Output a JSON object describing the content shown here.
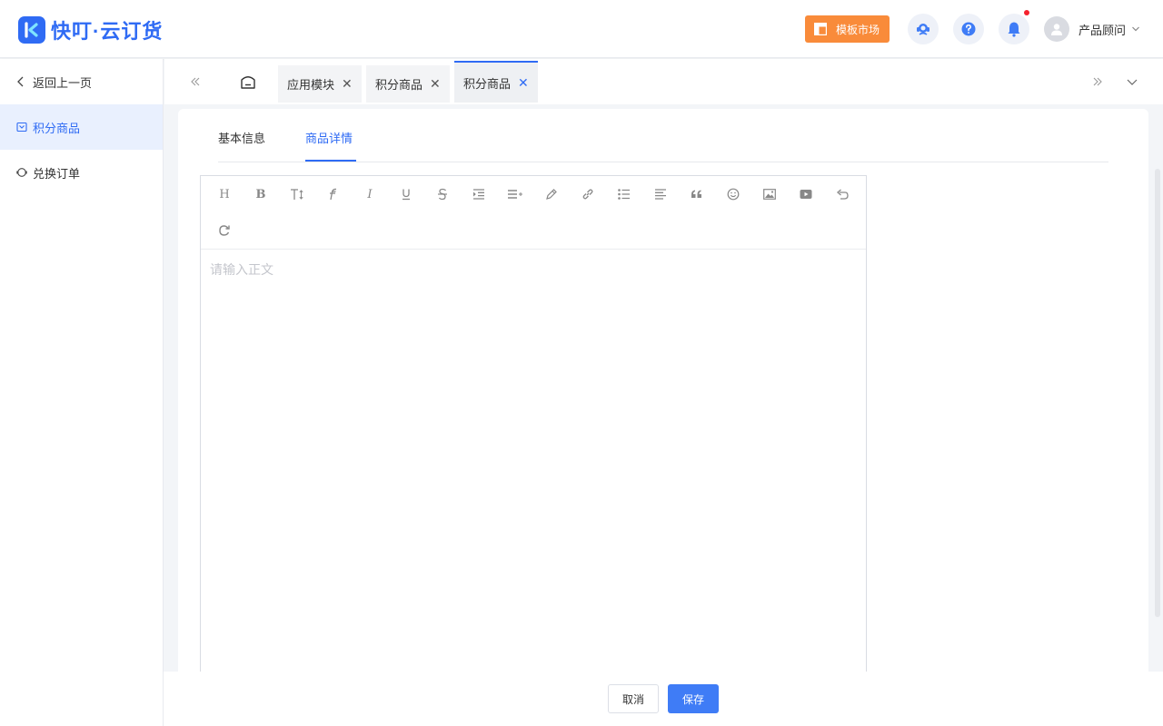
{
  "app": {
    "logo_text": "快叮·云订货",
    "brand_color": "#2f6bf4"
  },
  "header": {
    "template_market_label": "模板市场",
    "template_market_color": "#f98b3a",
    "icons": [
      "support-icon",
      "help-icon",
      "bell-icon"
    ],
    "user_name": "产品顾问"
  },
  "sidebar": {
    "back_label": "返回上一页",
    "items": [
      {
        "label": "积分商品",
        "icon": "box-icon",
        "active": true
      },
      {
        "label": "兑换订单",
        "icon": "exchange-icon",
        "active": false
      }
    ]
  },
  "tabs": [
    {
      "label": "应用模块",
      "active": false
    },
    {
      "label": "积分商品",
      "active": false
    },
    {
      "label": "积分商品",
      "active": true
    }
  ],
  "subtabs": [
    {
      "label": "基本信息",
      "active": false
    },
    {
      "label": "商品详情",
      "active": true
    }
  ],
  "editor": {
    "placeholder": "请输入正文",
    "toolbar": [
      "heading",
      "bold",
      "font-size",
      "font-family",
      "italic",
      "underline",
      "strikethrough",
      "indent",
      "line-height",
      "font-color",
      "link",
      "list",
      "justify",
      "quote",
      "emoticon",
      "image",
      "video",
      "undo",
      "redo"
    ]
  },
  "footer": {
    "cancel_label": "取消",
    "save_label": "保存"
  }
}
